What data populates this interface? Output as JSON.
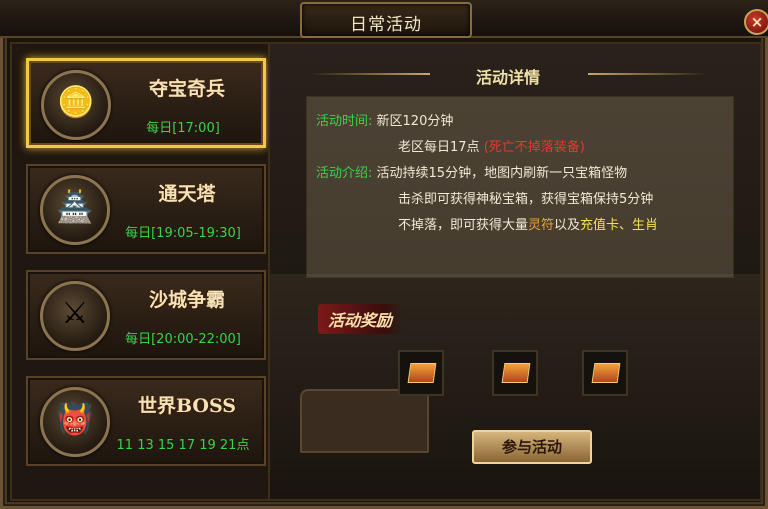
{
  "window": {
    "title": "日常活动",
    "close_label": "×"
  },
  "activities": [
    {
      "name": "夺宝奇兵",
      "time": "每日[17:00]",
      "icon": "treasure-ingot-icon",
      "selected": true
    },
    {
      "name": "通天塔",
      "time": "每日[19:05-19:30]",
      "icon": "pagoda-icon",
      "selected": false
    },
    {
      "name": "沙城争霸",
      "time": "每日[20:00-22:00]",
      "icon": "crossed-swords-icon",
      "selected": false
    },
    {
      "name": "世界BOSS",
      "time": "11 13 15 17 19 21点",
      "icon": "demon-crest-icon",
      "selected": false
    }
  ],
  "details": {
    "title": "活动详情",
    "time_label": "活动时间:",
    "time_new": "新区120分钟",
    "time_old": "老区每日17点",
    "time_old_note": "(死亡不掉落装备)",
    "intro_label": "活动介绍:",
    "intro_line1": "活动持续15分钟，地图内刷新一只宝箱怪物",
    "intro_line2": "击杀即可获得神秘宝箱，获得宝箱保持5分钟",
    "intro_line3_a": "不掉落，即可获得大量",
    "intro_line3_b": "灵符",
    "intro_line3_c": "以及",
    "intro_line3_d": "充值卡、生肖"
  },
  "rewards": {
    "title": "活动奖励",
    "items": [
      "reward-chest-icon",
      "reward-chest-icon",
      "reward-chest-icon"
    ]
  },
  "join_button": "参与活动",
  "colors": {
    "accent_gold": "#f2c84a",
    "time_green": "#38d44a",
    "warn_red": "#e23a32"
  }
}
